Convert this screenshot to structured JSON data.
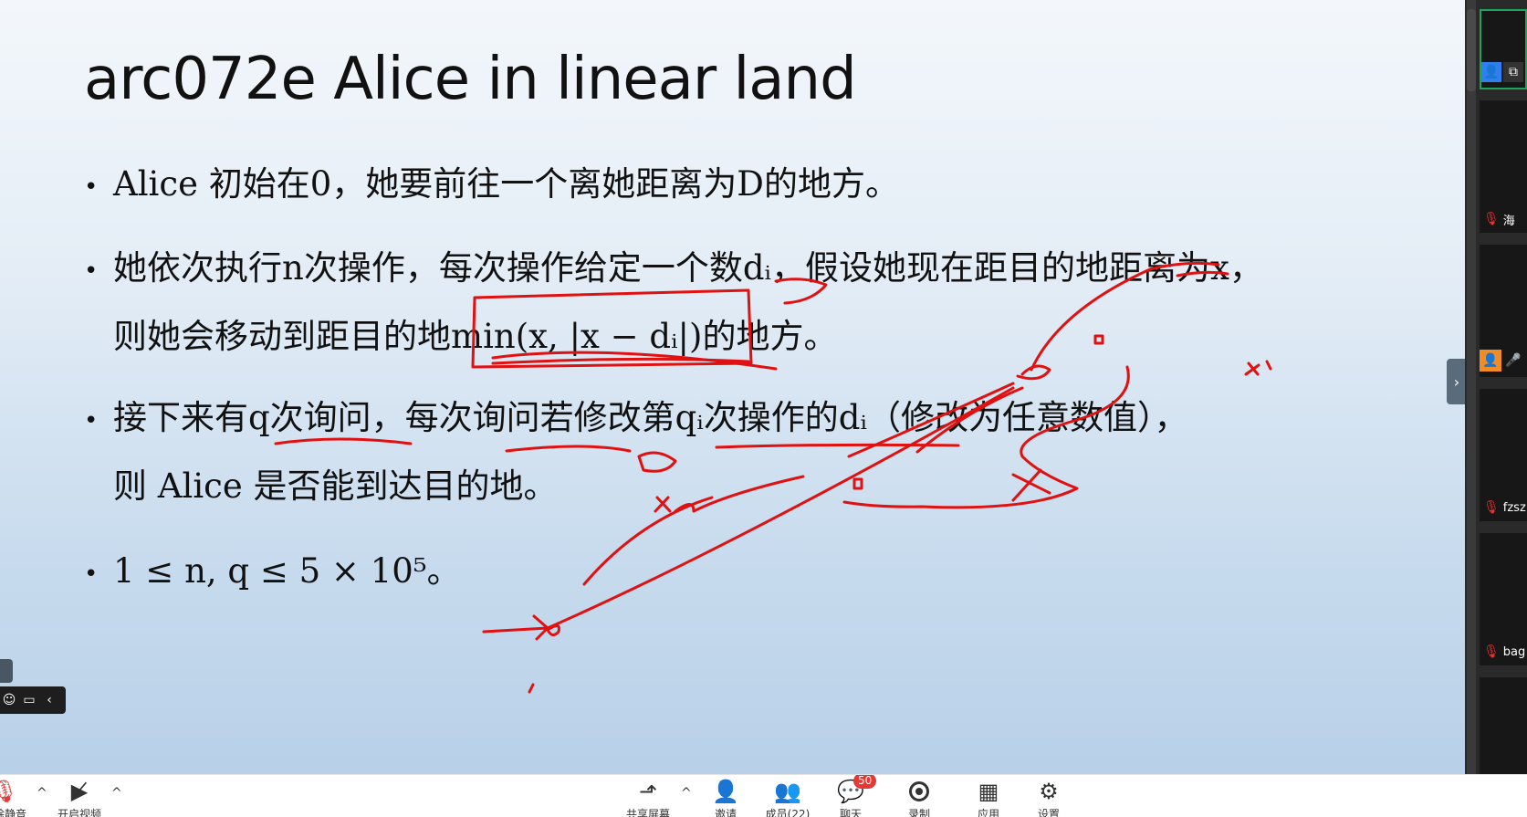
{
  "slide": {
    "title": "arc072e Alice in linear land",
    "bullets": [
      {
        "line1": "Alice 初始在0，她要前往一个离她距离为D的地方。"
      },
      {
        "line1": "她依次执行n次操作，每次操作给定一个数dᵢ，假设她现在距目的地距离为x，",
        "line2": "则她会移动到距目的地min(x, |x − dᵢ|)的地方。"
      },
      {
        "line1": "接下来有q次询问，每次询问若修改第qᵢ次操作的dᵢ（修改为任意数值），",
        "line2": "则 Alice 是否能到达目的地。"
      },
      {
        "line1": "1 ≤ n, q ≤ 5 × 10⁵。"
      }
    ],
    "background_top": "#f3f7fb",
    "background_bottom": "#b8d0e8",
    "ink_color": "#e01111"
  },
  "participants": [
    {
      "name": "",
      "state": "active-sharing",
      "icons": [
        "person-icon",
        "screen-share-icon"
      ]
    },
    {
      "name": "海",
      "state": "muted"
    },
    {
      "name": "",
      "state": "speaking",
      "icons": [
        "person-icon",
        "mic-icon"
      ]
    },
    {
      "name": "fzsz",
      "state": "muted"
    },
    {
      "name": "bag",
      "state": "muted"
    }
  ],
  "toolbar": {
    "mute_label": "解除静音",
    "video_label": "开启视频",
    "share_label": "共享屏幕",
    "invite_label": "邀请",
    "members_label": "成员(22)",
    "chat_label": "聊天",
    "chat_badge": "50",
    "record_label": "录制",
    "apps_label": "应用",
    "settings_label": "设置"
  },
  "float_widget": {
    "icons": [
      "emoji-icon",
      "chat-bubble-icon",
      "chevron-left-icon"
    ]
  },
  "colors": {
    "accent_green": "#1fa35a",
    "badge_red": "#e53935",
    "orange": "#f08c25",
    "blue": "#2f7ff0"
  }
}
